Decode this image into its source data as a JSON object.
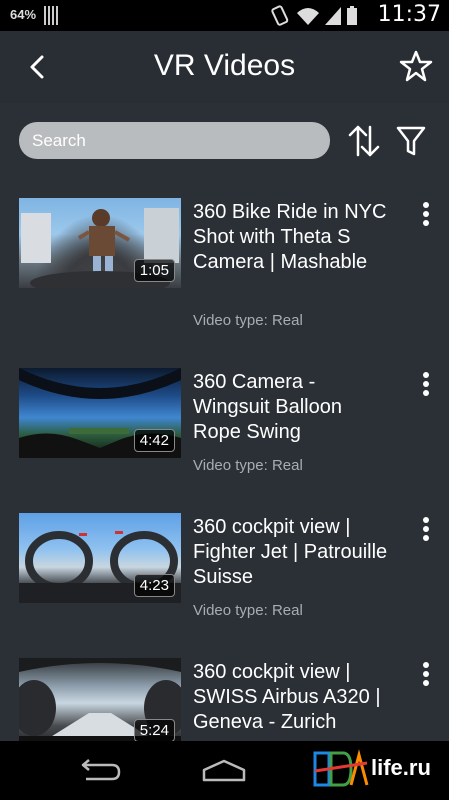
{
  "status_bar": {
    "battery_percent": "64%",
    "time": "11:37"
  },
  "app_bar": {
    "title": "VR Videos"
  },
  "search": {
    "placeholder": "Search"
  },
  "videos": [
    {
      "title": "360 Bike Ride in NYC Shot with Theta S Camera | Mashable",
      "duration": "1:05",
      "type": "Video type: Real"
    },
    {
      "title": "360 Camera - Wingsuit Balloon Rope Swing",
      "duration": "4:42",
      "type": "Video type: Real"
    },
    {
      "title": "360 cockpit view | Fighter Jet | Patrouille Suisse",
      "duration": "4:23",
      "type": "Video type: Real"
    },
    {
      "title": "360 cockpit view | SWISS Airbus A320 | Geneva - Zurich",
      "duration": "5:24",
      "type": ""
    }
  ],
  "watermark": {
    "logo_text": "PDA",
    "text": "life.ru"
  },
  "colors": {
    "app_bar_bg": "#282e33",
    "content_bg": "#2a3036",
    "search_bg": "#b9bcbf",
    "secondary_text": "#a8adb1"
  }
}
